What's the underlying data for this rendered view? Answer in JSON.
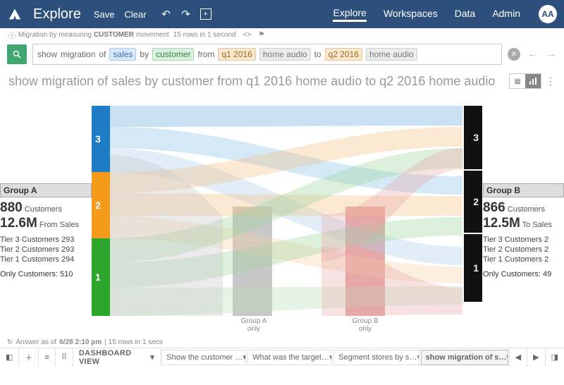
{
  "nav": {
    "brand": "Explore",
    "save": "Save",
    "clear": "Clear",
    "tabs": {
      "explore": "Explore",
      "workspaces": "Workspaces",
      "data": "Data",
      "admin": "Admin"
    },
    "avatar": "AA"
  },
  "hint": {
    "pre": "Migration by measuring ",
    "bold": "CUSTOMER",
    "post": " movement",
    "meta": "15 rows in 1 second"
  },
  "query": {
    "w_show": "show",
    "w_migration": "migration",
    "w_of": "of",
    "p_sales": "sales",
    "w_by": "by",
    "p_customer": "customer",
    "w_from": "from",
    "p_q1": "q1 2016",
    "p_ha1": "home audio",
    "w_to": "to",
    "p_q2": "q2 2016",
    "p_ha2": "home audio"
  },
  "title": "show migration of sales by customer from q1 2016 home audio to q2 2016 home audio",
  "groupA": {
    "header": "Group A",
    "count": "880",
    "count_lbl": " Customers",
    "metric": "12.6M",
    "metric_lbl": " From Sales",
    "tier3": "Tier 3 Customers 293",
    "tier2": "Tier 2 Customers 293",
    "tier1": "Tier 1 Customers 294",
    "only": "Only Customers: 510"
  },
  "groupB": {
    "header": "Group B",
    "count": "866",
    "count_lbl": " Customers",
    "metric": "12.5M",
    "metric_lbl": " To Sales",
    "tier3": "Tier 3 Customers 2",
    "tier2": "Tier 2 Customers 2",
    "tier1": "Tier 1 Customers 2",
    "only": "Only Customers: 49"
  },
  "tiers": {
    "l3": "3",
    "l2": "2",
    "l1": "1"
  },
  "mid": {
    "a": "Group A\nonly",
    "b": "Group B\nonly"
  },
  "footer": {
    "asof": "Answer as of ",
    "ts": "6/28 2:10 pm",
    "meta": " | 15 rows in 1 secs",
    "dash": "DASHBOARD VIEW",
    "pins": [
      "Show the customer …",
      "What was the target…",
      "Segment stores by s…",
      "show migration of s…"
    ]
  },
  "chart_data": {
    "type": "sankey",
    "left_group": "Group A",
    "right_group": "Group B",
    "left_total_customers": 880,
    "right_total_customers": 866,
    "left_from_sales": 12600000,
    "right_to_sales": 12500000,
    "left_tiers": [
      {
        "tier": 3,
        "customers": 293,
        "color": "#1f7cc4"
      },
      {
        "tier": 2,
        "customers": 293,
        "color": "#f49b1c"
      },
      {
        "tier": 1,
        "customers": 294,
        "color": "#2ca52c"
      }
    ],
    "left_only_customers": 510,
    "right_only_customers": 49,
    "mid_columns": [
      "Group A only",
      "Group B only"
    ]
  }
}
